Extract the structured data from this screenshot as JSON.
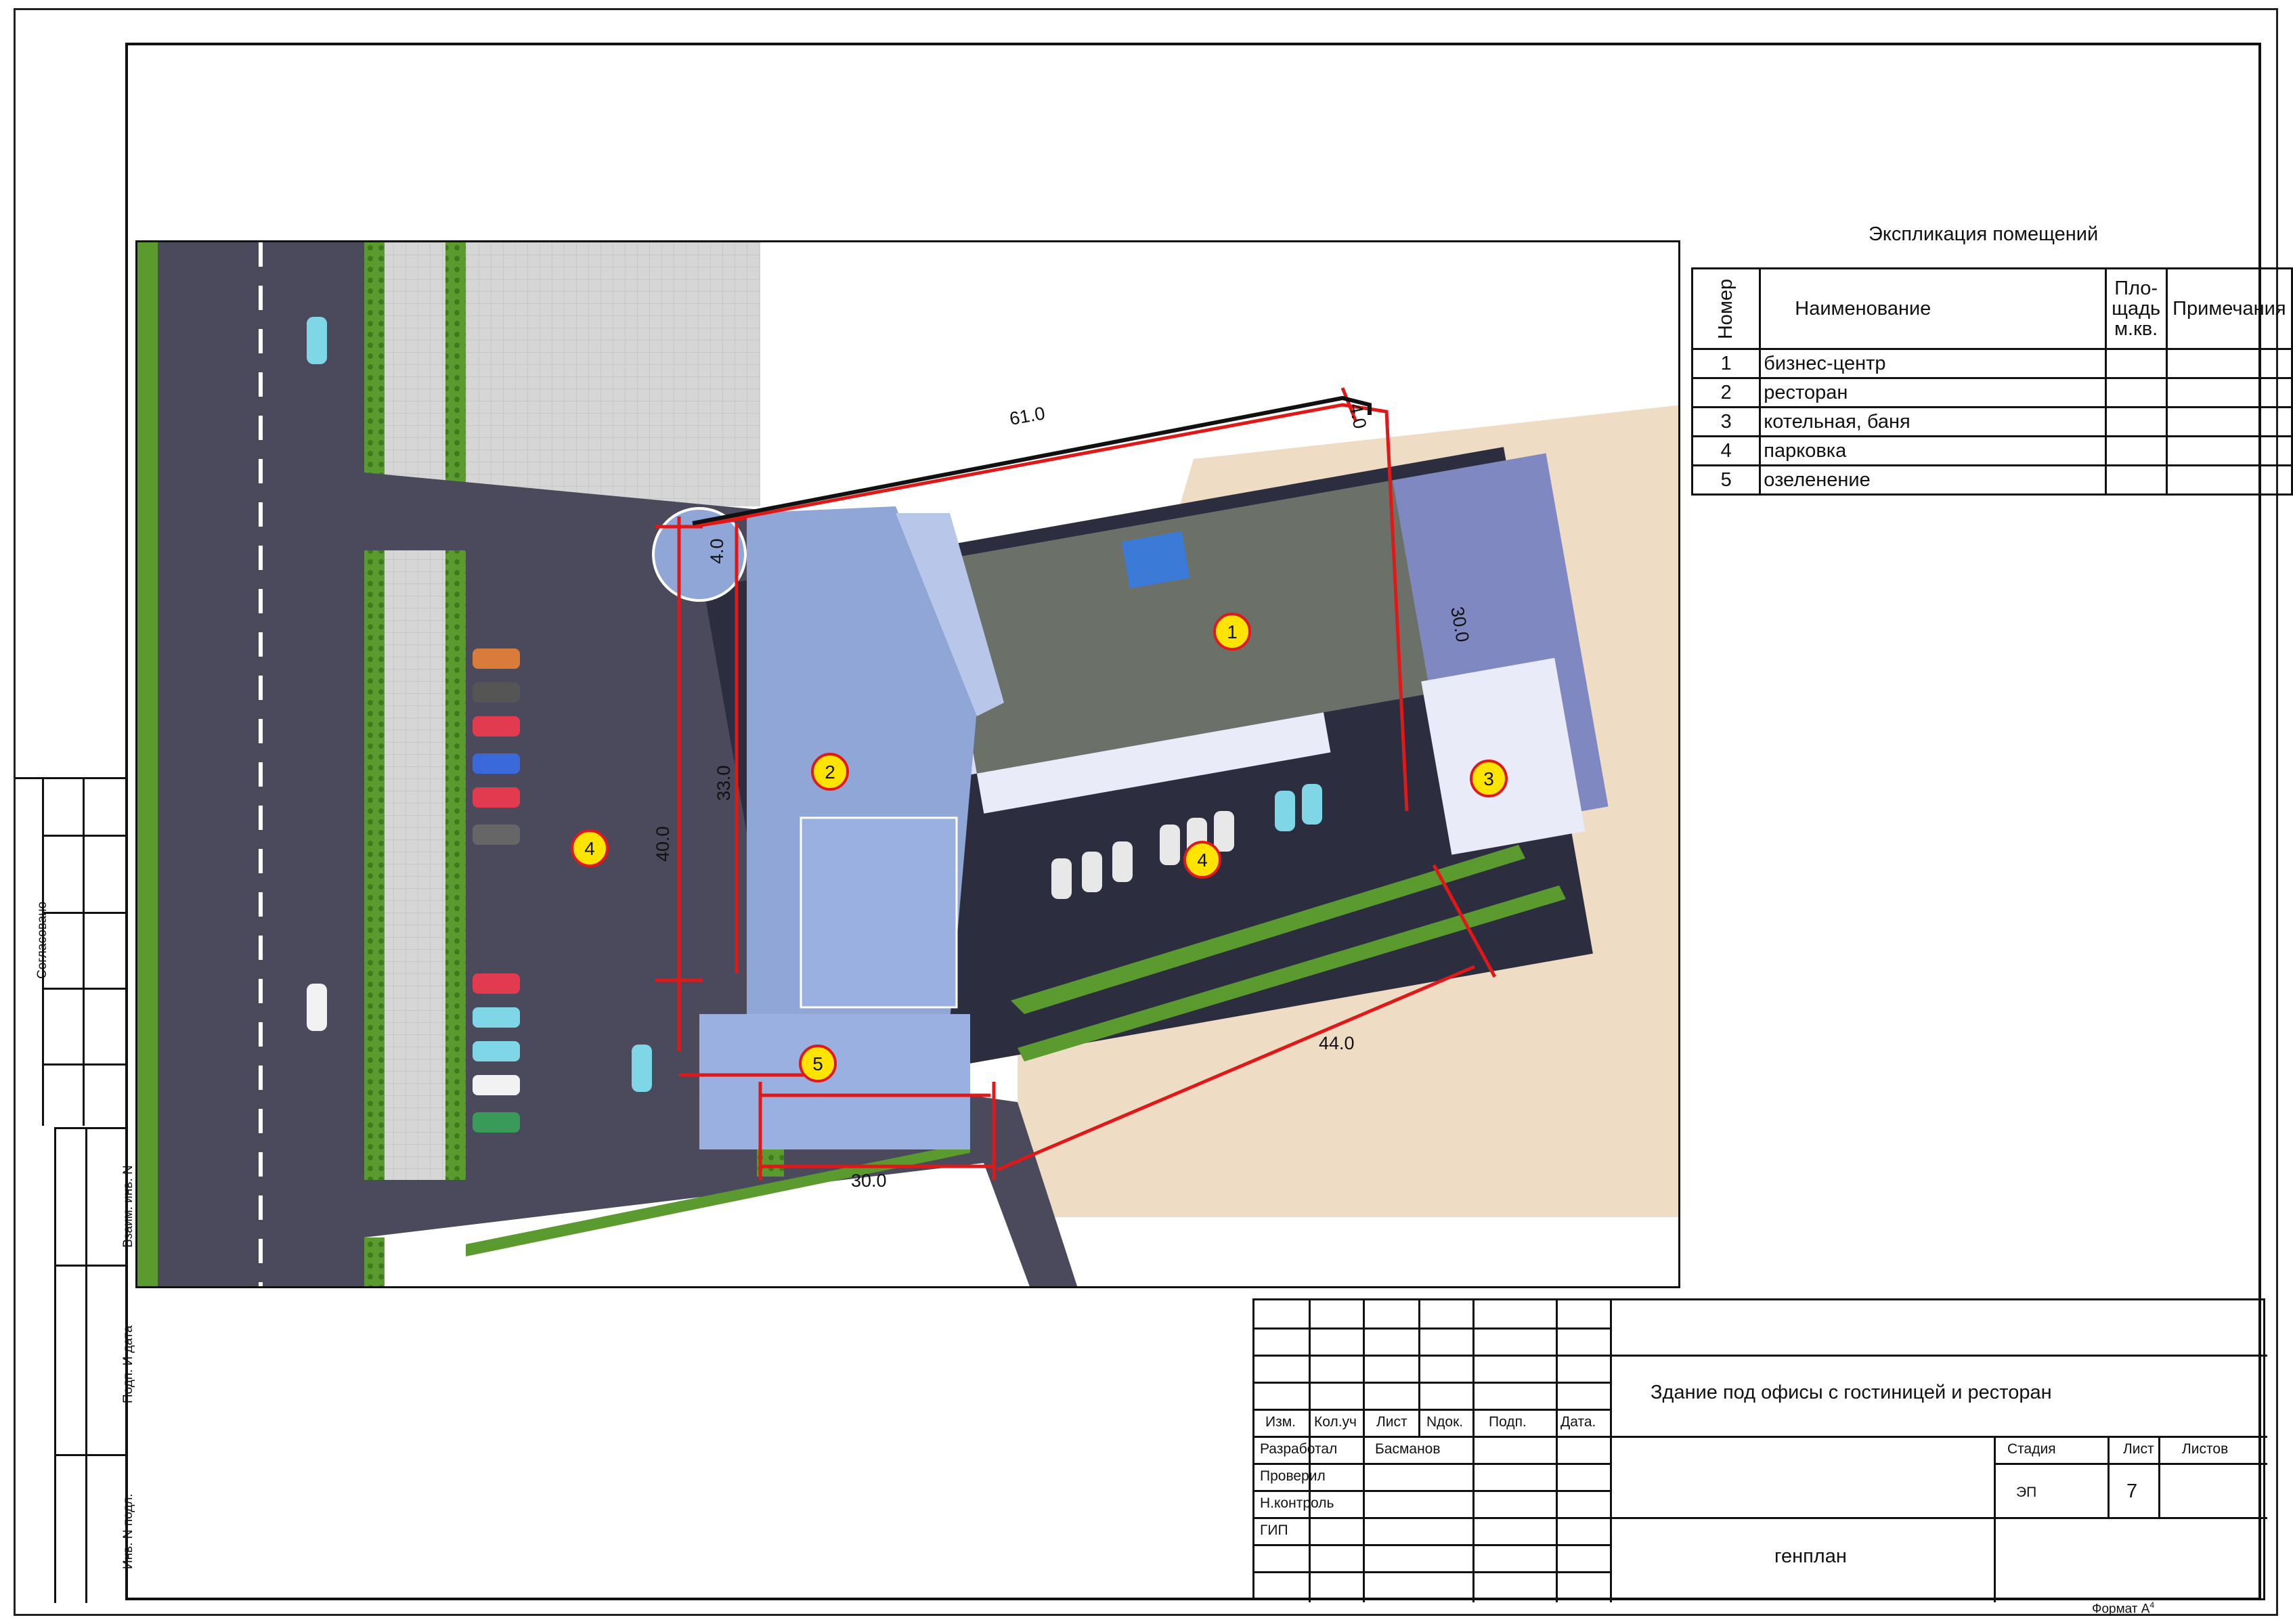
{
  "explication": {
    "title": "Экспликация помещений",
    "headers": {
      "number": "Номер",
      "name": "Наименование",
      "area": "Пло-\nщадь\nм.кв.",
      "notes": "Примечания"
    },
    "rows": [
      {
        "num": "1",
        "name": "бизнес-центр"
      },
      {
        "num": "2",
        "name": "ресторан"
      },
      {
        "num": "3",
        "name": "котельная, баня"
      },
      {
        "num": "4",
        "name": "парковка"
      },
      {
        "num": "5",
        "name": "озеленение"
      }
    ]
  },
  "plan": {
    "markers": [
      "1",
      "2",
      "3",
      "4",
      "4",
      "5"
    ],
    "dimensions": {
      "d61": "61.0",
      "d4a": "4.0",
      "d4b": "4.0",
      "d30a": "30.0",
      "d33": "33.0",
      "d40": "40.0",
      "d44": "44.0",
      "d30b": "30.0"
    },
    "colors": {
      "asphalt": "#4a4a5c",
      "grass": "#5a9a2e",
      "building": "#8fa6d6",
      "roof": "#6b7169",
      "sand": "#efdcc4",
      "dimension": "#e01818",
      "marker": "#ffe400"
    }
  },
  "side_stamps": {
    "soglasovano": "Согласовано",
    "vzaim": "Взаим. инв. N",
    "podp": "Подп. И дата",
    "inv": "Инв. N подл."
  },
  "title_block": {
    "cols": {
      "izm": "Изм.",
      "kolich": "Кол.уч",
      "list": "Лист",
      "ndok": "Nдок.",
      "podp": "Подп.",
      "data": "Дата."
    },
    "roles": [
      {
        "role": "Разработал",
        "name": "Басманов"
      },
      {
        "role": "Проверил",
        "name": ""
      },
      {
        "role": "Н.контроль",
        "name": ""
      },
      {
        "role": "ГИП",
        "name": ""
      }
    ],
    "project_name": "Здание под офисы с гостиницей и ресторан",
    "stage_label": "Стадия",
    "sheet_label": "Лист",
    "sheets_label": "Листов",
    "stage_value": "ЭП",
    "sheet_value": "7",
    "sheets_value": "",
    "drawing_name": "генплан"
  },
  "format_label": "Формат А",
  "format_sup": "4"
}
